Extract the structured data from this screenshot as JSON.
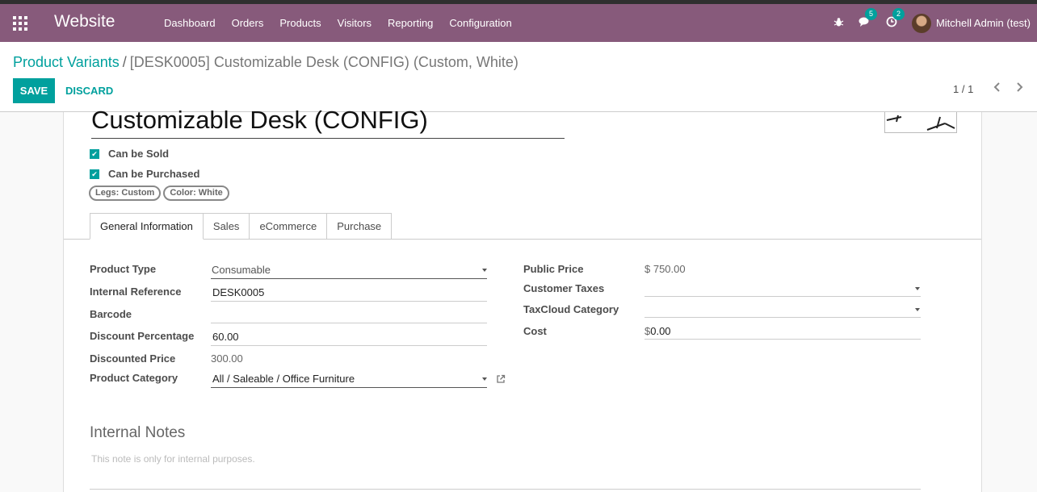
{
  "navbar": {
    "brand": "Website",
    "menu": [
      "Dashboard",
      "Orders",
      "Products",
      "Visitors",
      "Reporting",
      "Configuration"
    ],
    "messages_count": "5",
    "activities_count": "2",
    "user_name": "Mitchell Admin (test)"
  },
  "control_panel": {
    "breadcrumb_parent": "Product Variants",
    "breadcrumb_separator": "/",
    "breadcrumb_current": "[DESK0005] Customizable Desk (CONFIG) (Custom, White)",
    "save_label": "SAVE",
    "discard_label": "DISCARD",
    "pager": "1 / 1"
  },
  "form": {
    "product_name": "Customizable Desk (CONFIG)",
    "can_be_sold": "Can be Sold",
    "can_be_purchased": "Can be Purchased",
    "attribute_tags": [
      "Legs: Custom",
      "Color: White"
    ],
    "tabs": [
      "General Information",
      "Sales",
      "eCommerce",
      "Purchase"
    ],
    "active_tab": "General Information",
    "fields": {
      "product_type": {
        "label": "Product Type",
        "value": "Consumable"
      },
      "internal_reference": {
        "label": "Internal Reference",
        "value": "DESK0005"
      },
      "barcode": {
        "label": "Barcode",
        "value": ""
      },
      "discount_percentage": {
        "label": "Discount Percentage",
        "value": "60.00"
      },
      "discounted_price": {
        "label": "Discounted Price",
        "value": "300.00"
      },
      "product_category": {
        "label": "Product Category",
        "value": "All / Saleable / Office Furniture"
      },
      "public_price": {
        "label": "Public Price",
        "value": "$ 750.00"
      },
      "customer_taxes": {
        "label": "Customer Taxes",
        "value": ""
      },
      "taxcloud_category": {
        "label": "TaxCloud Category",
        "value": ""
      },
      "cost": {
        "label": "Cost",
        "currency": "$",
        "value": "0.00"
      }
    },
    "internal_notes": {
      "title": "Internal Notes",
      "placeholder": "This note is only for internal purposes."
    }
  },
  "colors": {
    "navbar": "#875a7b",
    "accent": "#00a09d"
  }
}
